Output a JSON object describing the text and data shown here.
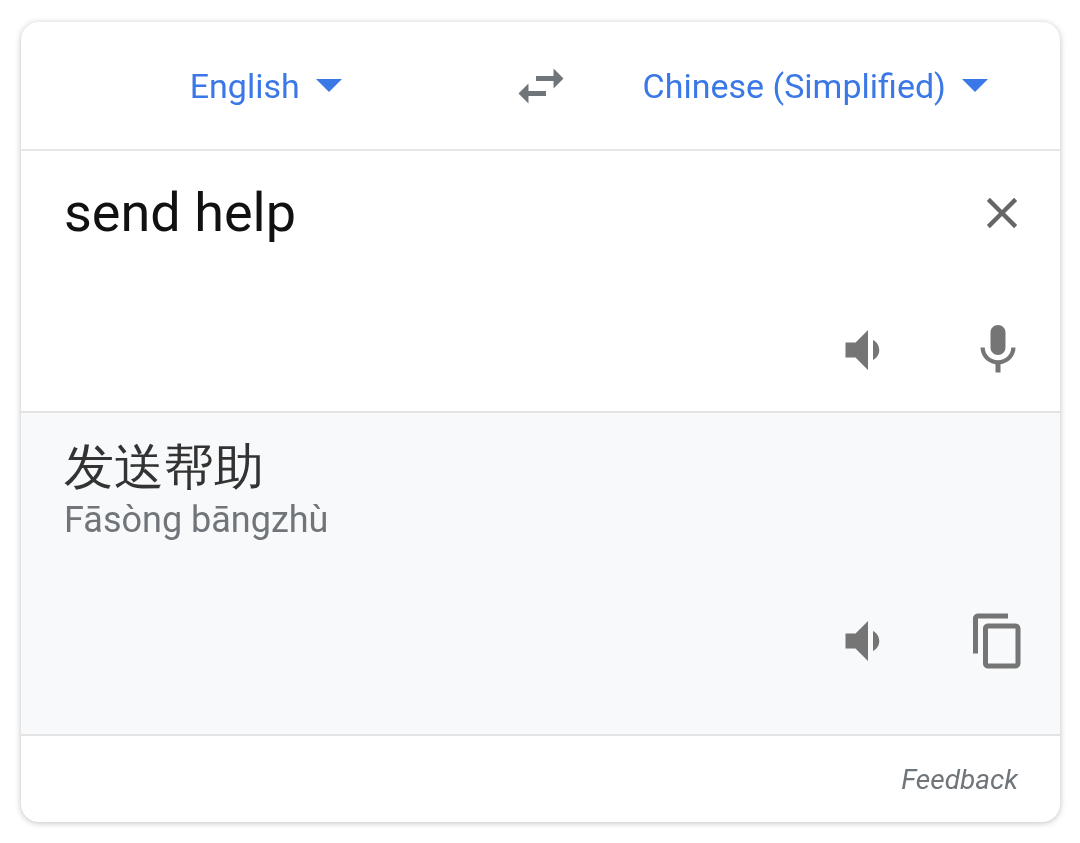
{
  "languages": {
    "source": "English",
    "target": "Chinese (Simplified)"
  },
  "input": {
    "value": "send help"
  },
  "output": {
    "translation": "发送帮助",
    "romanization": "Fāsòng bāngzhù"
  },
  "footer": {
    "link": "Feedback"
  }
}
